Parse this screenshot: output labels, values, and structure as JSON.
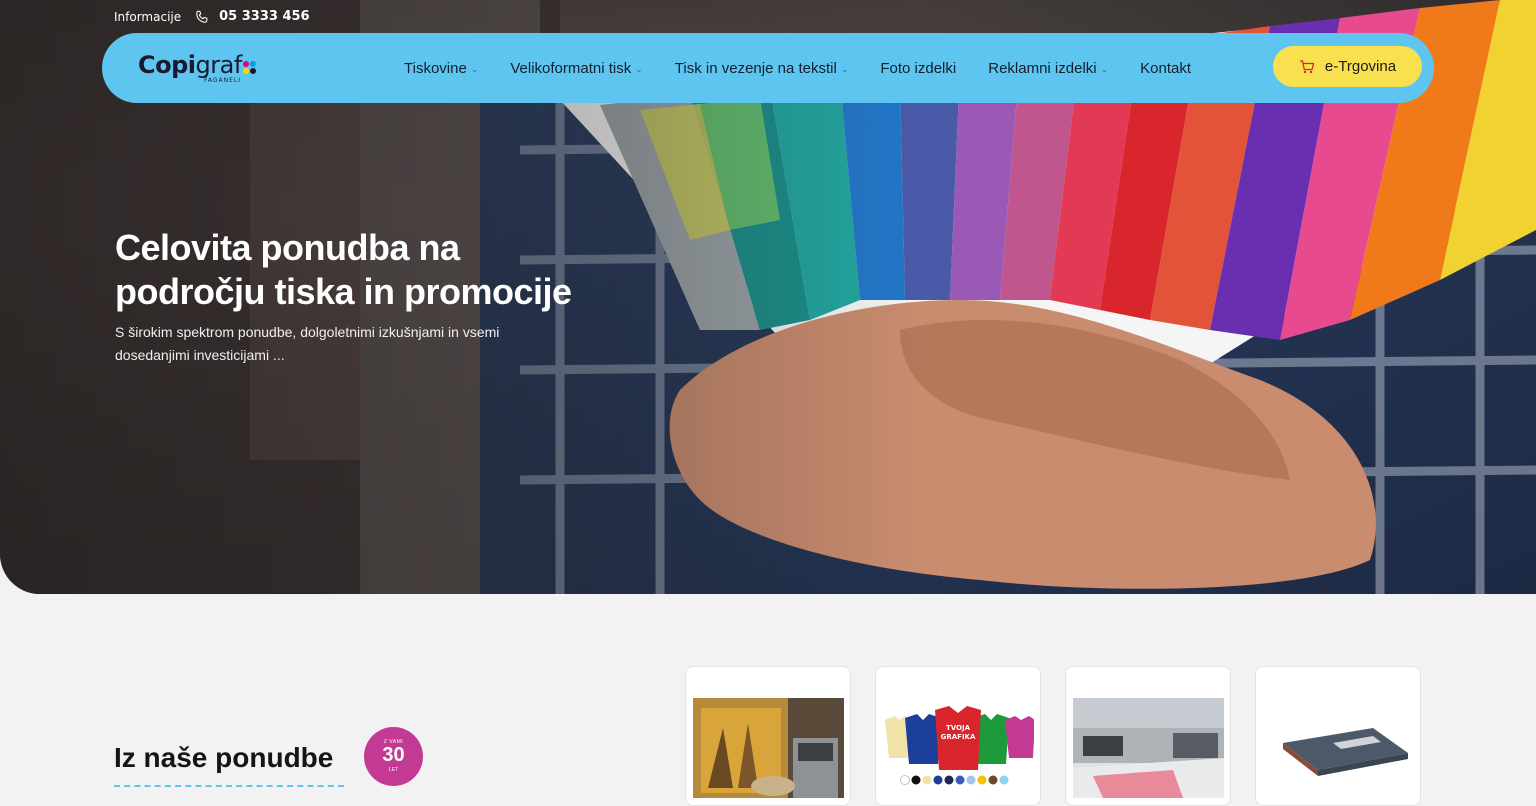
{
  "topbar": {
    "info_label": "Informacije",
    "phone": "05 3333 456"
  },
  "logo": {
    "brand_bold": "Copi",
    "brand_light": "graf",
    "subtitle": "FAGANELI",
    "dot_colors": [
      "#e6007e",
      "#00a0e3",
      "#ffd500",
      "#1a1a2e"
    ]
  },
  "nav": {
    "items": [
      {
        "label": "Tiskovine",
        "has_dropdown": true
      },
      {
        "label": "Velikoformatni tisk",
        "has_dropdown": true
      },
      {
        "label": "Tisk in vezenje na tekstil",
        "has_dropdown": true
      },
      {
        "label": "Foto izdelki",
        "has_dropdown": false
      },
      {
        "label": "Reklamni izdelki",
        "has_dropdown": true
      },
      {
        "label": "Kontakt",
        "has_dropdown": false
      }
    ],
    "shop_button": "e-Trgovina",
    "shop_icon": "cart-icon"
  },
  "hero": {
    "title_line1": "Celovita ponudba na",
    "title_line2": "področju tiska in promocije",
    "lead": "S širokim spektrom ponudbe, dolgoletnimi izkušnjami in vsemi dosedanjimi investicijami ..."
  },
  "offer": {
    "title": "Iz naše ponudbe",
    "badge": {
      "top": "Z VAMI",
      "number": "30",
      "bottom": "LET"
    },
    "cards": [
      {
        "name": "card-wall-print"
      },
      {
        "name": "card-textile-print",
        "shirt_text_1": "TVOJA",
        "shirt_text_2": "GRAFIKA"
      },
      {
        "name": "card-print-hall"
      },
      {
        "name": "card-catalogs"
      }
    ]
  },
  "colors": {
    "nav_bg": "#5ec5f1",
    "shop_bg": "#f8e04e",
    "badge_bg": "#c23a93",
    "page_bg": "#f2f2f3"
  }
}
